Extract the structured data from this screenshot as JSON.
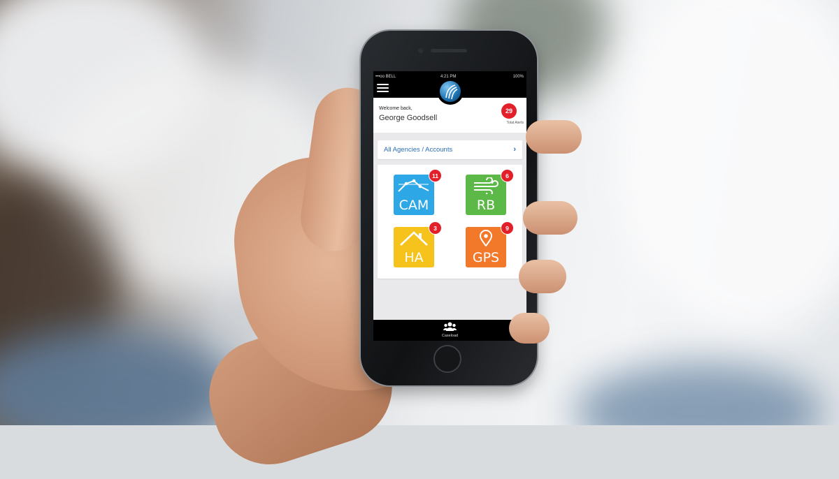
{
  "status_bar": {
    "carrier": "•••oo BELL",
    "time": "4:21 PM",
    "battery": "100%"
  },
  "header": {
    "menu_icon": "hamburger-menu-icon",
    "logo_icon": "company-logo"
  },
  "welcome": {
    "greeting": "Welcome back,",
    "user_name": "George Goodsell"
  },
  "alerts": {
    "total": "29",
    "label": "Total Alerts"
  },
  "agencies": {
    "label": "All Agencies / Accounts",
    "chevron": "›"
  },
  "tiles": [
    {
      "label": "CAM",
      "badge": "11",
      "icon": "camera-network-icon",
      "color": "#2ea7e6"
    },
    {
      "label": "RB",
      "badge": "6",
      "icon": "wind-icon",
      "color": "#5cb847"
    },
    {
      "label": "HA",
      "badge": "3",
      "icon": "home-icon",
      "color": "#f6c21c"
    },
    {
      "label": "GPS",
      "badge": "9",
      "icon": "map-pin-icon",
      "color": "#f2782a"
    }
  ],
  "tab_bar": {
    "label": "Caseload",
    "icon": "people-group-icon"
  }
}
